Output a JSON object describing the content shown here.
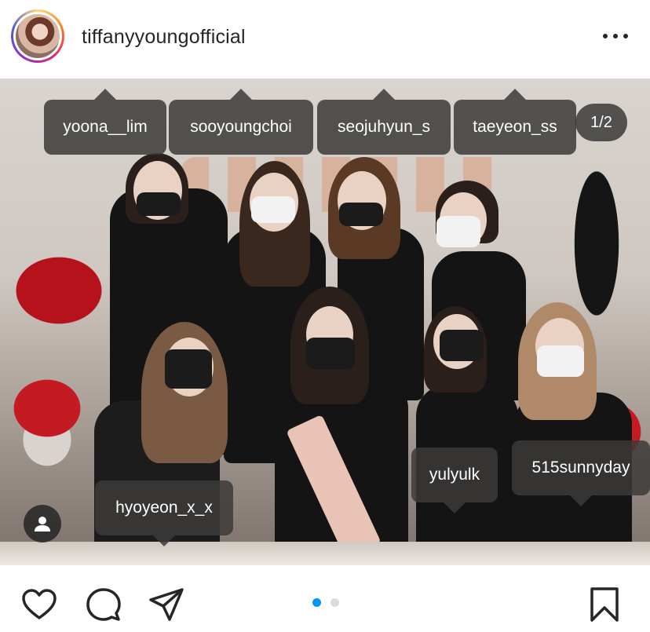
{
  "header": {
    "username": "tiffanyyoungofficial",
    "more_icon": "more-horizontal-icon"
  },
  "photo": {
    "counter": "1/2",
    "tags": [
      {
        "label": "yoona__lim"
      },
      {
        "label": "sooyoungchoi"
      },
      {
        "label": "seojuhyun_s"
      },
      {
        "label": "taeyeon_ss"
      },
      {
        "label": "yulyulk"
      },
      {
        "label": "515sunnyday"
      },
      {
        "label": "hyoyeon_x_x"
      }
    ],
    "user_tag_icon": "person-icon"
  },
  "actions": {
    "like_icon": "heart-icon",
    "comment_icon": "comment-icon",
    "share_icon": "send-icon",
    "save_icon": "bookmark-icon",
    "carousel": {
      "total": 2,
      "current": 1
    },
    "accent_color": "#0095f6"
  }
}
